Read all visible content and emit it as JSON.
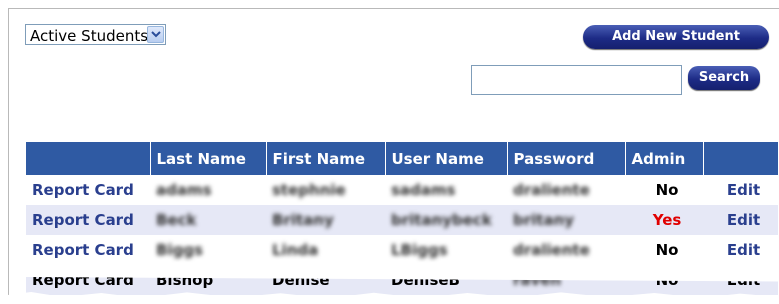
{
  "filter": {
    "selected": "Active Students"
  },
  "actions": {
    "add_label": "Add New Student",
    "search_label": "Search",
    "search_value": ""
  },
  "colors": {
    "header_bg": "#2f5aa3",
    "link": "#2a3f8e",
    "yes": "#e00000",
    "alt_row": "#e6e8f6"
  },
  "table": {
    "headers": [
      "",
      "Last Name",
      "First Name",
      "User Name",
      "Password",
      "Admin",
      ""
    ],
    "rows": [
      {
        "action": "Report Card",
        "last": "adams",
        "first": "stephnie",
        "user": "sadams",
        "password": "draliente",
        "admin": "No",
        "edit": "Edit"
      },
      {
        "action": "Report Card",
        "last": "Beck",
        "first": "Britany",
        "user": "britanybeck",
        "password": "britany",
        "admin": "Yes",
        "edit": "Edit"
      },
      {
        "action": "Report Card",
        "last": "Biggs",
        "first": "Linda",
        "user": "LBiggs",
        "password": "draliente",
        "admin": "No",
        "edit": "Edit"
      },
      {
        "action": "Report Card",
        "last": "Bishop",
        "first": "Denise",
        "user": "DeniseB",
        "password": "raven",
        "admin": "No",
        "edit": "Edit"
      }
    ]
  }
}
